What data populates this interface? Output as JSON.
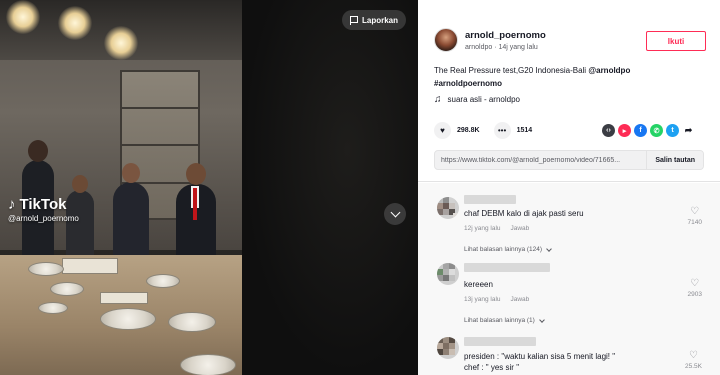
{
  "video": {
    "report_label": "Laporkan",
    "watermark_brand": "TikTok",
    "watermark_handle": "@arnold_poernomo"
  },
  "author": {
    "username": "arnold_poernomo",
    "handle": "arnoldpo",
    "time_ago": "14j yang lalu",
    "follow_label": "Ikuti"
  },
  "post": {
    "caption": "The Real Pressure test",
    "caption_rest": ",G20 Indonesia-Bali ",
    "caption_tag1": "@arnoldpo",
    "caption_tag2": "#arnoldpoernomo",
    "music": "suara asli - arnoldpo",
    "likes": "298.8K",
    "comments": "1514"
  },
  "share": {
    "url": "https://www.tiktok.com/@arnold_poernomo/video/71665...",
    "copy_label": "Salin tautan",
    "icons": [
      {
        "name": "embed-icon",
        "color": "#3b3d44",
        "glyph": "‹›"
      },
      {
        "name": "send-icon",
        "color": "#fe2c55",
        "glyph": "▸"
      },
      {
        "name": "facebook-icon",
        "color": "#1877f2",
        "glyph": "f"
      },
      {
        "name": "whatsapp-icon",
        "color": "#25d366",
        "glyph": "✆"
      },
      {
        "name": "twitter-icon",
        "color": "#1da1f2",
        "glyph": "t"
      },
      {
        "name": "share-arrow-icon",
        "color": "#ffffff",
        "glyph": "➦"
      }
    ]
  },
  "comments": [
    {
      "text": "chaf DEBM kalo di ajak pasti seru",
      "time": "12j yang lalu",
      "reply": "Jawab",
      "replies_label": "Lihat balasan lainnya (124)",
      "likes": "7140"
    },
    {
      "text": "kereeen",
      "time": "13j yang lalu",
      "reply": "Jawab",
      "replies_label": "Lihat balasan lainnya (1)",
      "likes": "2903"
    },
    {
      "text": "presiden : \"waktu kalian sisa 5 menit lagi! \"",
      "text2": "chef : \" yes sir \"",
      "likes": "25.5K"
    }
  ]
}
